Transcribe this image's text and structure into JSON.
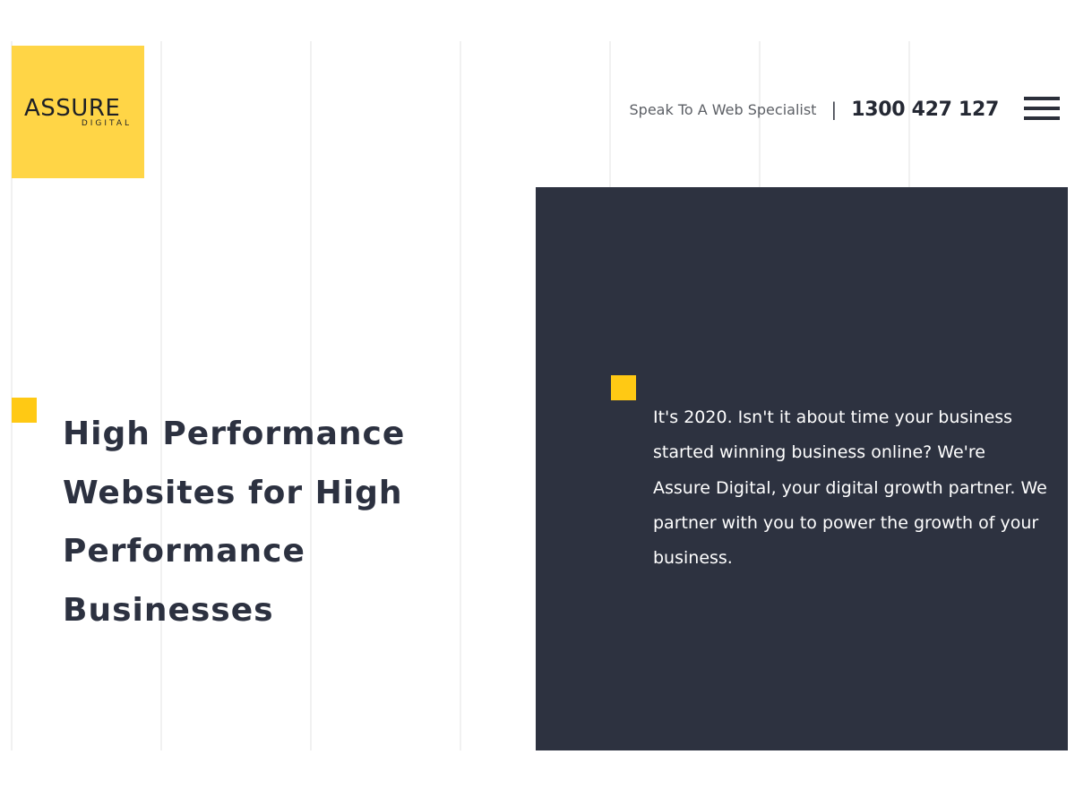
{
  "brand": {
    "name": "ASSURE",
    "tagline": "DIGITAL",
    "color": "#ffd546"
  },
  "header": {
    "cta_label": "Speak To A Web Specialist",
    "separator": "|",
    "phone": "1300 427 127",
    "menu_icon": "hamburger-menu-icon"
  },
  "hero": {
    "title": "High Performance Websites for High Performance Businesses",
    "accent_color": "#ffc914"
  },
  "intro": {
    "text": "It's 2020. Isn't it about time your business started winning business online? We're Assure Digital, your digital growth partner. We partner with you to power the growth of your business.",
    "panel_color": "#2d3240"
  }
}
